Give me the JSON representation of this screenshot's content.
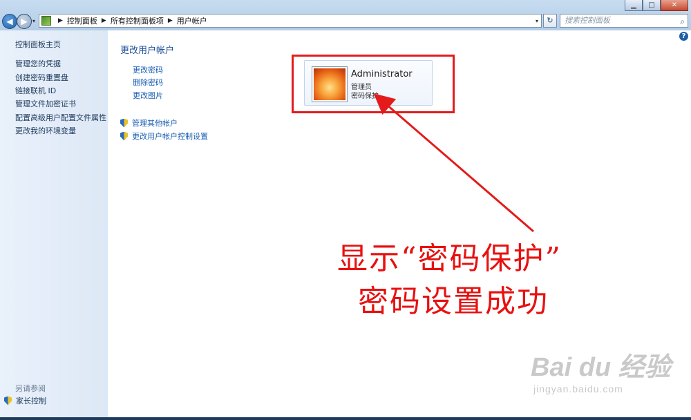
{
  "window": {
    "minimize": "▁",
    "maximize": "□",
    "close": "✕"
  },
  "navigation": {
    "back": "◀",
    "forward": "▶",
    "dropdown": "▾",
    "breadcrumbs": [
      "控制面板",
      "所有控制面板项",
      "用户帐户"
    ],
    "refresh": "↻",
    "search_placeholder": "搜索控制面板"
  },
  "sidebar": {
    "home": "控制面板主页",
    "items": [
      {
        "label": "管理您的凭据"
      },
      {
        "label": "创建密码重置盘"
      },
      {
        "label": "链接联机 ID"
      },
      {
        "label": "管理文件加密证书"
      },
      {
        "label": "配置高级用户配置文件属性"
      },
      {
        "label": "更改我的环境变量"
      }
    ],
    "see_also": "另请参阅",
    "family_safety": "家长控制"
  },
  "main": {
    "title": "更改用户帐户",
    "tasks": [
      "更改密码",
      "删除密码",
      "更改图片"
    ],
    "admin_tasks": [
      "管理其他帐户",
      "更改用户帐户控制设置"
    ]
  },
  "account": {
    "name": "Administrator",
    "role": "管理员",
    "status": "密码保护"
  },
  "annotation": {
    "line1": "显示“密码保护”",
    "line2": "密码设置成功",
    "color": "#e81010"
  },
  "watermark": {
    "brand": "Bai du 经验",
    "url": "jingyan.baidu.com"
  },
  "help": "?"
}
